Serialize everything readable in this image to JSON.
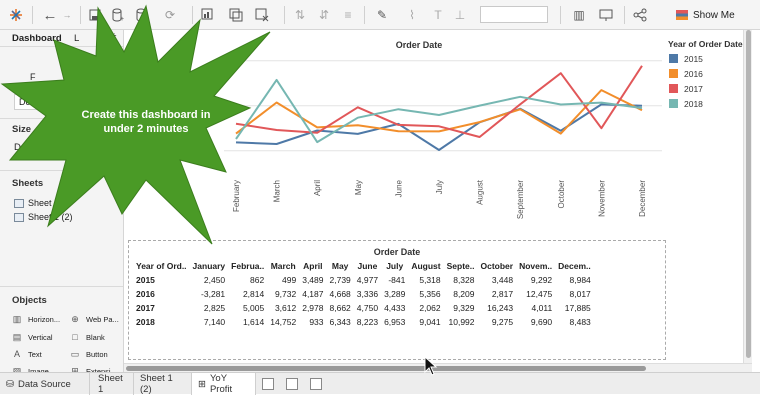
{
  "toolbar": {
    "show_me_label": "Show Me",
    "icons": [
      "tableau-logo-icon",
      "undo-icon",
      "redo-icon",
      "save-icon",
      "new-datasource-icon",
      "pause-icon",
      "refresh-icon",
      "new-worksheet-icon",
      "duplicate-icon",
      "clear-icon",
      "swap-icon",
      "sort-ascending-icon",
      "sort-descending-icon",
      "highlight-icon",
      "group-icon",
      "label-icon",
      "fit-dropdown",
      "fix-axes-icon",
      "presentation-icon",
      "share-icon"
    ]
  },
  "left_panel": {
    "tab_dashboard": "Dashboard",
    "tab_layout": "L",
    "device_button_prefix": "Device",
    "fit_text": "F",
    "size_header": "Size",
    "size_value": "Desktop B",
    "sheets_header": "Sheets",
    "sheets": [
      "Sheet",
      "Sheet 1 (2)"
    ],
    "objects_header": "Objects",
    "objects": [
      {
        "label": "Horizon...",
        "icon": "horizontal-icon"
      },
      {
        "label": "Web Pa...",
        "icon": "globe-icon"
      },
      {
        "label": "Vertical",
        "icon": "vertical-icon"
      },
      {
        "label": "Blank",
        "icon": "blank-icon"
      },
      {
        "label": "Text",
        "icon": "text-icon"
      },
      {
        "label": "Button",
        "icon": "button-icon"
      },
      {
        "label": "Image",
        "icon": "image-icon"
      },
      {
        "label": "Extensi",
        "icon": "extension-icon"
      }
    ]
  },
  "callout": {
    "line1": "Create this dashboard in",
    "line2": "under 2 minutes"
  },
  "chart_data": [
    {
      "type": "line",
      "title": "Order Date",
      "categories": [
        "February",
        "March",
        "April",
        "May",
        "June",
        "July",
        "August",
        "September",
        "October",
        "November",
        "December"
      ],
      "legend_title": "Year of Order Date",
      "legend_position": "right",
      "series": [
        {
          "name": "2015",
          "color": "#4e79a7",
          "values": [
            862,
            499,
            3489,
            2739,
            4977,
            -841,
            5318,
            8328,
            3448,
            9292,
            8984
          ]
        },
        {
          "name": "2016",
          "color": "#f28e2b",
          "values": [
            2814,
            9732,
            4187,
            4668,
            3336,
            3289,
            5356,
            8209,
            2817,
            12475,
            8017
          ]
        },
        {
          "name": "2017",
          "color": "#e15759",
          "values": [
            5005,
            3612,
            2978,
            8662,
            4750,
            4433,
            2062,
            9329,
            16243,
            4011,
            17885
          ]
        },
        {
          "name": "2018",
          "color": "#76b7b2",
          "values": [
            1614,
            14752,
            933,
            6343,
            8223,
            6953,
            9041,
            10992,
            9275,
            9690,
            8483
          ]
        }
      ],
      "ylim": [
        -1500,
        18500
      ]
    },
    {
      "type": "table",
      "title": "Order Date",
      "row_header": "Year of Ord..",
      "columns": [
        "January",
        "Februa..",
        "March",
        "April",
        "May",
        "June",
        "July",
        "August",
        "Septe..",
        "October",
        "Novem..",
        "Decem.."
      ],
      "rows": [
        {
          "year": "2015",
          "values": [
            "2,450",
            "862",
            "499",
            "3,489",
            "2,739",
            "4,977",
            "-841",
            "5,318",
            "8,328",
            "3,448",
            "9,292",
            "8,984"
          ]
        },
        {
          "year": "2016",
          "values": [
            "-3,281",
            "2,814",
            "9,732",
            "4,187",
            "4,668",
            "3,336",
            "3,289",
            "5,356",
            "8,209",
            "2,817",
            "12,475",
            "8,017"
          ]
        },
        {
          "year": "2017",
          "values": [
            "2,825",
            "5,005",
            "3,612",
            "2,978",
            "8,662",
            "4,750",
            "4,433",
            "2,062",
            "9,329",
            "16,243",
            "4,011",
            "17,885"
          ]
        },
        {
          "year": "2018",
          "values": [
            "7,140",
            "1,614",
            "14,752",
            "933",
            "6,343",
            "8,223",
            "6,953",
            "9,041",
            "10,992",
            "9,275",
            "9,690",
            "8,483"
          ]
        }
      ]
    }
  ],
  "bottom_tabs": {
    "data_source": "Data Source",
    "sheet1": "Sheet 1",
    "sheet1_2": "Sheet 1 (2)",
    "yoy_profit": "YoY Profit"
  }
}
